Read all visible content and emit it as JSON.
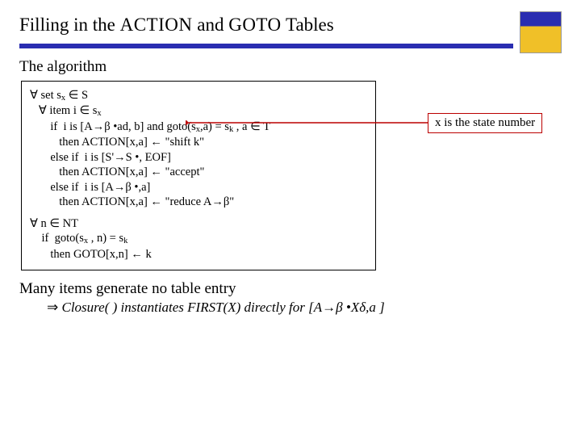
{
  "title": {
    "pre": "Filling in the ",
    "kw1": "ACTION",
    "mid": " and ",
    "kw2": "GOTO",
    "post": " Tables"
  },
  "subhead": "The algorithm",
  "algo": {
    "l1a": "∀ set s",
    "l1b": " ∈ S",
    "l2a": "   ∀ item i ∈ s",
    "l3a": "       if  i is [A→β •a",
    "l3b": "d, b",
    "l3c": "] and goto(s",
    "l3d": ",a",
    "l3e": ") = s",
    "l3f": " , a",
    "l3g": " ∈ T",
    "l4a": "          then ACTION[x,a",
    "l4b": "] ← \"shift k\"",
    "l5": "       else if  i is [S'→S •, EOF]",
    "l6a": "          then ACTION[x,a",
    "l6b": "] ← \"accept\"",
    "l7": "       else if  i is [A→β •,a]",
    "l8a": "          then ACTION[x,a",
    "l8b": "] ← \"reduce A→β\"",
    "b2l1": "∀ n ∈ NT",
    "b2l2a": "    if  goto(s",
    "b2l2b": " , n) = s",
    "b2l3": "       then GOTO[x,n] ← k"
  },
  "annotation": "x is the state number",
  "footer": {
    "main": "Many items generate no table entry",
    "sub_pre": "Closure( ) instantiates FIRST(X) directly for [A",
    "sub_post": " •Xδ,a ]"
  },
  "sub": {
    "x": "x",
    "k": "k"
  },
  "glyph": {
    "arrow": "→",
    "bigarrow": "⇒",
    "beta": "β"
  }
}
